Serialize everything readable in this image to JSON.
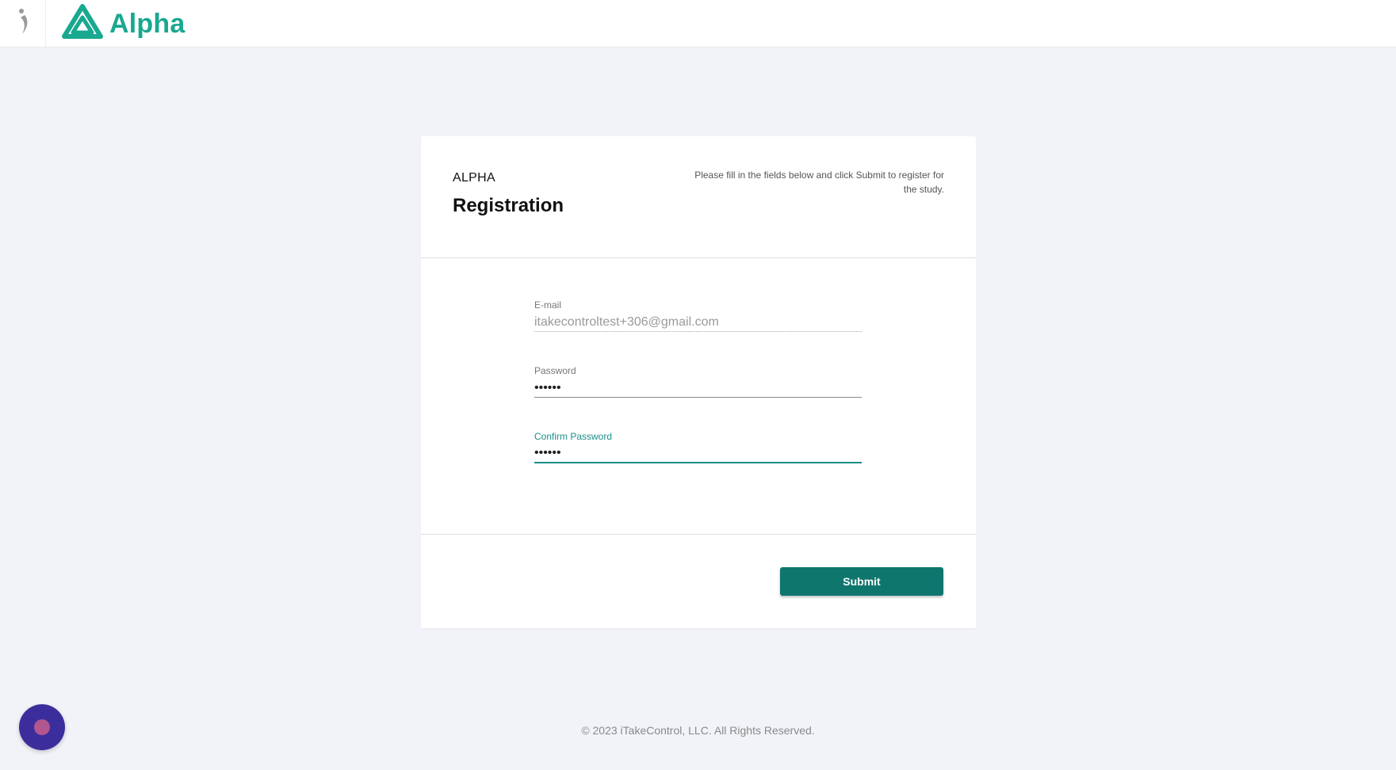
{
  "header": {
    "brand_name": "Alpha",
    "brand_color": "#19a890",
    "left_icon": "runner-icon",
    "logo_icon": "alpha-logo-icon"
  },
  "card": {
    "subtitle": "ALPHA",
    "title": "Registration",
    "instructions": "Please fill in the fields below and click Submit to register for the study.",
    "fields": {
      "email": {
        "label": "E-mail",
        "value": "itakecontroltest+306@gmail.com",
        "disabled": true
      },
      "password": {
        "label": "Password",
        "value": "••••••"
      },
      "confirm_password": {
        "label": "Confirm Password",
        "value": "••••••",
        "focused": true
      }
    },
    "submit_label": "Submit",
    "accent_color": "#0f766e"
  },
  "footer": {
    "copyright": "© 2023 iTakeControl, LLC. All Rights Reserved."
  },
  "fab": {
    "icon": "chat-bubble-icon",
    "color": "#3b2e9c"
  }
}
